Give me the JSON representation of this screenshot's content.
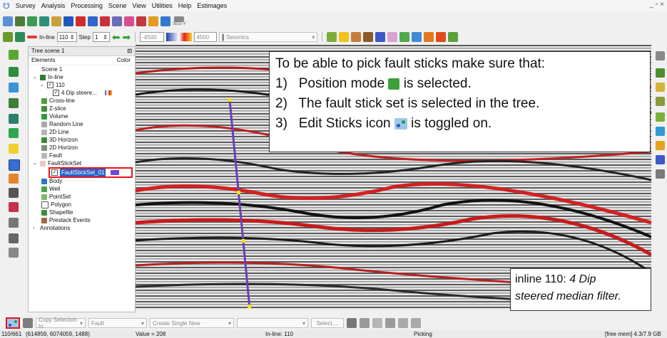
{
  "menubar": {
    "items": [
      "Survey",
      "Analysis",
      "Processing",
      "Scene",
      "View",
      "Utilities",
      "Help",
      "Estimages"
    ]
  },
  "toolbar1": {
    "segy_label": "SEG-Y"
  },
  "toolbar2": {
    "inline_label": "In-line",
    "inline_value": "110",
    "step_label": "Step",
    "step_value": "1",
    "color_min": "-4500",
    "color_max": "4500",
    "attribute": "Seismics"
  },
  "tree": {
    "title": "Tree scene 1",
    "col_elements": "Elements",
    "col_color": "Color",
    "items": [
      "Scene 1",
      "In-line",
      "110",
      "4 Dip steere...",
      "Cross-line",
      "Z-slice",
      "Volume",
      "Random Line",
      "2D Line",
      "3D Horizon",
      "2D Horizon",
      "Fault",
      "FaultStickSet",
      "FaultStickSet_01",
      "Body",
      "Well",
      "PointSet",
      "Polygon",
      "Shapefile",
      "Prestack Events",
      "Annotations"
    ]
  },
  "instructions": {
    "line1": "To be able to pick fault sticks make sure that:",
    "line2_num": "1)",
    "line2": "Position mode",
    "line2_end": "is selected.",
    "line3_num": "2)",
    "line3": "The fault stick set is selected in the tree.",
    "line4_num": "3)",
    "line4": "Edit Sticks icon",
    "line4_end": "is toggled on."
  },
  "caption": {
    "line1_prefix": "inline 110: ",
    "line1_italic": "4 Dip",
    "line2_italic": "steered median filter."
  },
  "bottom_toolbar": {
    "copy_selection": "Copy Selection to",
    "target": "Fault",
    "mode": "Create Single New",
    "select_btn": "Select ..."
  },
  "status": {
    "position": "110/661",
    "coords": "(614859, 6074059, 1488)",
    "value": "Value = 208",
    "inline": "In-line: 110",
    "mode": "Picking",
    "memory": "[free mem] 4.3/7.9 GB"
  },
  "colors": {
    "highlight_box": "#e8141c",
    "fault_stick": "#6a3fb5",
    "stick_nodes": "#f5e400"
  }
}
